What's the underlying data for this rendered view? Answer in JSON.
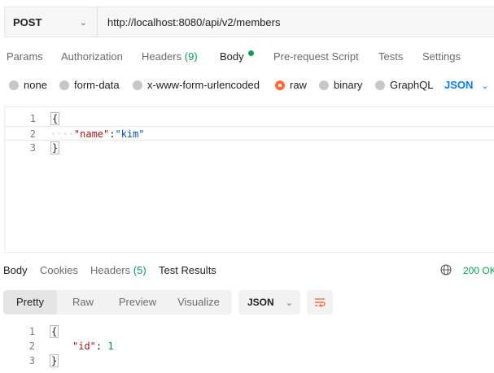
{
  "request": {
    "method": "POST",
    "url": "http://localhost:8080/api/v2/members"
  },
  "request_tabs": [
    {
      "label": "Params"
    },
    {
      "label": "Authorization"
    },
    {
      "label": "Headers",
      "count": "(9)"
    },
    {
      "label": "Body"
    },
    {
      "label": "Pre-request Script"
    },
    {
      "label": "Tests"
    },
    {
      "label": "Settings"
    }
  ],
  "body_types": [
    "none",
    "form-data",
    "x-www-form-urlencoded",
    "raw",
    "binary",
    "GraphQL"
  ],
  "body_format": "JSON",
  "request_body": {
    "line_numbers": [
      "1",
      "2",
      "3"
    ],
    "open": "{",
    "key": "\"name\"",
    "colon": ":",
    "value": "\"kim\"",
    "close": "}"
  },
  "response_tabs": [
    {
      "label": "Body"
    },
    {
      "label": "Cookies"
    },
    {
      "label": "Headers",
      "count": "(5)"
    },
    {
      "label": "Test Results"
    }
  ],
  "response_status": "200 OK",
  "response_views": [
    "Pretty",
    "Raw",
    "Preview",
    "Visualize"
  ],
  "response_format": "JSON",
  "response_body": {
    "line_numbers": [
      "1",
      "2",
      "3"
    ],
    "open": "{",
    "key": "\"id\"",
    "colon": ": ",
    "value": "1",
    "close": "}"
  },
  "colors": {
    "accent_orange": "#ff6c37",
    "accent_blue": "#097bed",
    "success_green": "#0f9d58"
  }
}
